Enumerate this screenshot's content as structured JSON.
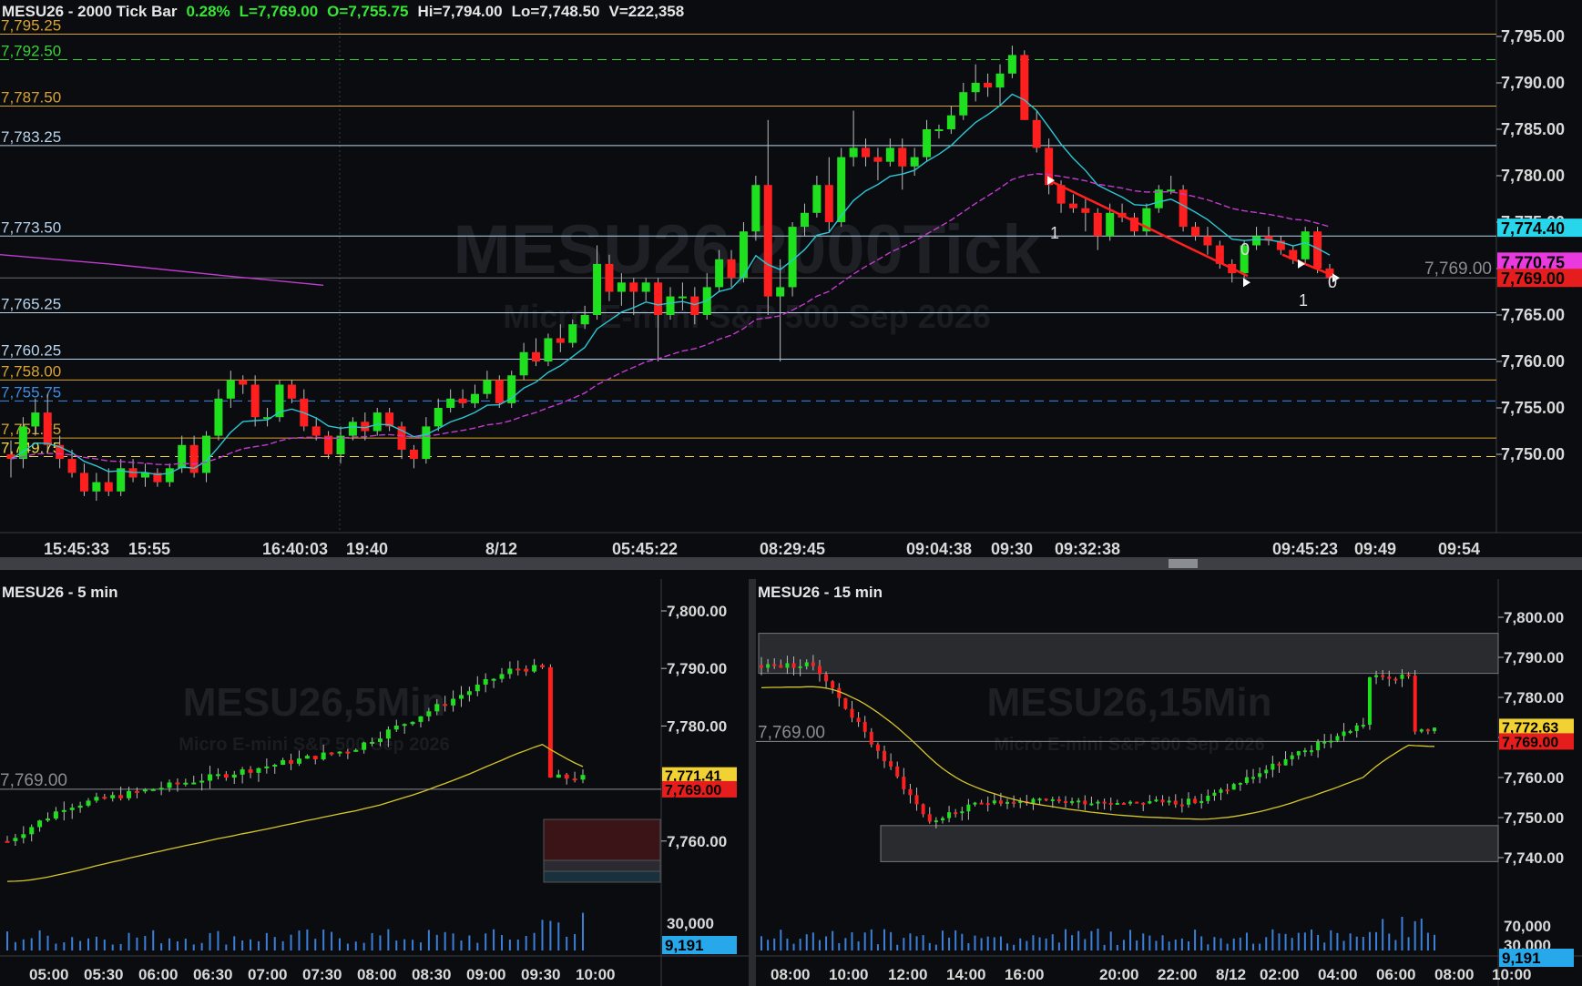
{
  "main": {
    "header": {
      "title": "MESU26 - 2000 Tick Bar",
      "change": "0.28%",
      "last": "L=7,769.00",
      "open": "O=7,755.75",
      "high": "Hi=7,794.00",
      "low": "Lo=7,748.50",
      "volume": "V=222,358"
    },
    "watermark": "MESU26,2000Tick",
    "watermark_sub": "Micro E-mini S&P 500 Sep 2026",
    "price_axis": [
      "7,795.00",
      "7,790.00",
      "7,785.00",
      "7,780.00",
      "7,775.00",
      "7,770.00",
      "7,765.00",
      "7,760.00",
      "7,755.00",
      "7,750.00"
    ],
    "levels": [
      {
        "label": "7,795.25",
        "price": 7795.25,
        "color": "#d8a330",
        "style": "solid"
      },
      {
        "label": "7,792.50",
        "price": 7792.5,
        "color": "#3ad13a",
        "style": "dashed"
      },
      {
        "label": "7,787.50",
        "price": 7787.5,
        "color": "#d8a330",
        "style": "solid"
      },
      {
        "label": "7,783.25",
        "price": 7783.25,
        "color": "#b8d4ee",
        "style": "solid"
      },
      {
        "label": "7,773.50",
        "price": 7773.5,
        "color": "#b8d4ee",
        "style": "solid"
      },
      {
        "label": "7,765.25",
        "price": 7765.25,
        "color": "#b8d4ee",
        "style": "solid"
      },
      {
        "label": "7,760.25",
        "price": 7760.25,
        "color": "#b8d4ee",
        "style": "solid"
      },
      {
        "label": "7,758.00",
        "price": 7758.0,
        "color": "#d8a330",
        "style": "solid"
      },
      {
        "label": "7,755.75",
        "price": 7755.75,
        "color": "#3a8ee8",
        "style": "dashed"
      },
      {
        "label": "7,751.75",
        "price": 7751.75,
        "color": "#d8a330",
        "style": "solid"
      },
      {
        "label": "7,749.75",
        "price": 7749.75,
        "color": "#f2d84a",
        "style": "dashed"
      }
    ],
    "last_price_line_label": "7,769.00",
    "price_tags": [
      {
        "text": "7,774.40",
        "price": 7774.4,
        "bg": "#27d6ea",
        "fg": "#000000"
      },
      {
        "text": "7,770.75",
        "price": 7770.75,
        "bg": "#e93ae0",
        "fg": "#000000"
      },
      {
        "text": "7,769.00",
        "price": 7769.0,
        "bg": "#e61d1d",
        "fg": "#000000"
      }
    ],
    "time_axis": [
      "15:45:33",
      "15:55",
      "16:40:03",
      "19:40",
      "8/12",
      "05:45:22",
      "08:29:45",
      "09:04:38",
      "09:30",
      "09:32:38",
      "09:45:23",
      "09:49",
      "09:54"
    ],
    "markers": [
      "1",
      "0",
      "0",
      "1"
    ],
    "candles": [
      [
        7750.0,
        7749.5,
        7747.5,
        7751.5
      ],
      [
        7749.5,
        7753.0,
        7748.5,
        7754.0
      ],
      [
        7753.0,
        7754.5,
        7752.0,
        7756.0
      ],
      [
        7754.5,
        7751.0,
        7750.5,
        7756.5
      ],
      [
        7751.0,
        7749.5,
        7748.5,
        7752.0
      ],
      [
        7749.5,
        7748.0,
        7747.5,
        7750.5
      ],
      [
        7748.0,
        7746.0,
        7745.5,
        7749.0
      ],
      [
        7746.0,
        7747.0,
        7745.0,
        7748.0
      ],
      [
        7747.0,
        7746.0,
        7745.5,
        7748.5
      ],
      [
        7746.0,
        7748.5,
        7745.5,
        7749.5
      ],
      [
        7748.5,
        7747.5,
        7747.0,
        7749.5
      ],
      [
        7747.5,
        7748.0,
        7746.5,
        7749.0
      ],
      [
        7748.0,
        7747.0,
        7746.5,
        7748.5
      ],
      [
        7747.0,
        7748.5,
        7746.5,
        7749.0
      ],
      [
        7748.5,
        7751.0,
        7748.0,
        7752.0
      ],
      [
        7751.0,
        7748.0,
        7747.5,
        7752.0
      ],
      [
        7748.0,
        7752.0,
        7747.0,
        7752.5
      ],
      [
        7752.0,
        7756.0,
        7751.5,
        7757.0
      ],
      [
        7756.0,
        7758.0,
        7755.0,
        7759.0
      ],
      [
        7758.0,
        7757.5,
        7756.5,
        7758.5
      ],
      [
        7757.5,
        7754.0,
        7753.0,
        7758.5
      ],
      [
        7754.0,
        7754.0,
        7753.0,
        7755.0
      ],
      [
        7754.0,
        7757.5,
        7753.5,
        7758.0
      ],
      [
        7757.5,
        7756.0,
        7755.5,
        7758.0
      ],
      [
        7756.0,
        7753.0,
        7752.5,
        7757.0
      ],
      [
        7753.0,
        7752.0,
        7751.5,
        7754.0
      ],
      [
        7752.0,
        7750.0,
        7749.5,
        7752.5
      ],
      [
        7750.0,
        7752.0,
        7749.0,
        7753.0
      ],
      [
        7752.0,
        7753.5,
        7751.5,
        7754.0
      ],
      [
        7753.5,
        7752.5,
        7751.5,
        7754.5
      ],
      [
        7752.5,
        7754.5,
        7752.0,
        7755.0
      ],
      [
        7754.5,
        7753.0,
        7752.5,
        7755.0
      ],
      [
        7753.0,
        7750.5,
        7749.5,
        7753.5
      ],
      [
        7750.5,
        7749.5,
        7748.5,
        7751.0
      ],
      [
        7749.5,
        7753.0,
        7749.0,
        7754.0
      ],
      [
        7753.0,
        7755.0,
        7752.5,
        7756.0
      ],
      [
        7755.0,
        7756.0,
        7754.5,
        7757.0
      ],
      [
        7756.0,
        7755.5,
        7755.0,
        7757.0
      ],
      [
        7755.5,
        7756.5,
        7755.0,
        7757.5
      ],
      [
        7756.5,
        7758.0,
        7756.0,
        7759.0
      ],
      [
        7758.0,
        7755.5,
        7755.0,
        7758.5
      ],
      [
        7755.5,
        7758.5,
        7755.0,
        7759.0
      ],
      [
        7758.5,
        7761.0,
        7758.0,
        7762.0
      ],
      [
        7761.0,
        7760.0,
        7759.5,
        7762.5
      ],
      [
        7760.0,
        7762.5,
        7759.5,
        7763.0
      ],
      [
        7762.5,
        7762.0,
        7761.0,
        7764.0
      ],
      [
        7762.0,
        7764.0,
        7761.5,
        7764.5
      ],
      [
        7764.0,
        7765.0,
        7763.5,
        7766.0
      ],
      [
        7765.0,
        7770.5,
        7764.5,
        7772.5
      ],
      [
        7770.5,
        7767.5,
        7766.5,
        7771.5
      ],
      [
        7767.5,
        7768.5,
        7766.0,
        7769.5
      ],
      [
        7768.5,
        7767.5,
        7765.0,
        7769.0
      ],
      [
        7767.5,
        7768.5,
        7766.5,
        7769.0
      ],
      [
        7768.5,
        7765.0,
        7760.0,
        7769.0
      ],
      [
        7765.0,
        7767.0,
        7764.5,
        7768.0
      ],
      [
        7767.0,
        7767.0,
        7765.5,
        7768.5
      ],
      [
        7767.0,
        7765.0,
        7764.0,
        7768.0
      ],
      [
        7765.0,
        7768.0,
        7764.5,
        7769.5
      ],
      [
        7768.0,
        7771.0,
        7767.5,
        7772.0
      ],
      [
        7771.0,
        7769.0,
        7768.0,
        7772.0
      ],
      [
        7769.0,
        7774.0,
        7768.5,
        7775.0
      ],
      [
        7774.0,
        7779.0,
        7773.0,
        7780.0
      ],
      [
        7779.0,
        7767.0,
        7765.0,
        7786.0
      ],
      [
        7767.0,
        7768.0,
        7760.0,
        7771.0
      ],
      [
        7768.0,
        7774.5,
        7767.0,
        7775.0
      ],
      [
        7774.5,
        7776.0,
        7773.5,
        7777.0
      ],
      [
        7776.0,
        7779.0,
        7775.5,
        7780.0
      ],
      [
        7779.0,
        7775.0,
        7774.0,
        7782.0
      ],
      [
        7775.0,
        7782.0,
        7774.5,
        7783.0
      ],
      [
        7782.0,
        7783.0,
        7781.0,
        7787.0
      ],
      [
        7783.0,
        7782.0,
        7781.0,
        7784.0
      ],
      [
        7782.0,
        7781.5,
        7779.5,
        7783.0
      ],
      [
        7781.5,
        7783.0,
        7781.0,
        7784.0
      ],
      [
        7783.0,
        7781.0,
        7778.5,
        7784.0
      ],
      [
        7781.0,
        7782.0,
        7780.0,
        7783.0
      ],
      [
        7782.0,
        7785.0,
        7781.5,
        7786.0
      ],
      [
        7785.0,
        7785.0,
        7784.0,
        7785.5
      ],
      [
        7785.0,
        7786.5,
        7784.5,
        7787.5
      ],
      [
        7786.5,
        7789.0,
        7786.0,
        7790.0
      ],
      [
        7789.0,
        7790.0,
        7788.0,
        7792.0
      ],
      [
        7790.0,
        7789.5,
        7788.5,
        7791.0
      ],
      [
        7789.5,
        7791.0,
        7787.5,
        7792.0
      ],
      [
        7791.0,
        7793.0,
        7790.5,
        7794.0
      ],
      [
        7793.0,
        7786.0,
        7786.0,
        7793.5
      ],
      [
        7786.0,
        7783.0,
        7782.5,
        7787.0
      ],
      [
        7783.0,
        7779.0,
        7778.0,
        7784.0
      ],
      [
        7779.0,
        7777.0,
        7776.0,
        7779.5
      ],
      [
        7777.0,
        7776.5,
        7776.0,
        7778.0
      ],
      [
        7776.5,
        7776.0,
        7774.0,
        7777.5
      ],
      [
        7776.0,
        7773.5,
        7772.0,
        7776.5
      ],
      [
        7773.5,
        7776.0,
        7773.0,
        7777.0
      ],
      [
        7776.0,
        7775.5,
        7775.0,
        7777.0
      ],
      [
        7775.5,
        7774.0,
        7773.5,
        7776.0
      ],
      [
        7774.0,
        7776.5,
        7773.5,
        7777.0
      ],
      [
        7776.5,
        7778.5,
        7776.0,
        7779.0
      ],
      [
        7778.5,
        7778.5,
        7778.0,
        7780.0
      ],
      [
        7778.5,
        7774.5,
        7774.0,
        7779.0
      ],
      [
        7774.5,
        7773.5,
        7773.0,
        7775.0
      ],
      [
        7773.5,
        7772.5,
        7771.5,
        7774.5
      ],
      [
        7772.5,
        7770.5,
        7770.0,
        7773.0
      ],
      [
        7770.5,
        7769.5,
        7768.5,
        7771.0
      ],
      [
        7769.5,
        7772.5,
        7769.0,
        7773.0
      ],
      [
        7772.5,
        7773.5,
        7772.0,
        7774.5
      ],
      [
        7773.5,
        7773.0,
        7772.5,
        7774.5
      ],
      [
        7773.0,
        7772.0,
        7771.5,
        7773.5
      ],
      [
        7772.0,
        7771.0,
        7770.5,
        7772.5
      ],
      [
        7771.0,
        7774.0,
        7770.5,
        7774.5
      ],
      [
        7774.0,
        7770.0,
        7769.5,
        7774.5
      ],
      [
        7770.0,
        7769.0,
        7768.0,
        7770.5
      ]
    ],
    "volume_hint": ""
  },
  "p5": {
    "title": "MESU26 - 5 min",
    "watermark": "MESU26,5Min",
    "watermark_sub": "Micro E-mini S&P 500 Sep 2026",
    "price_axis": [
      "7,800.00",
      "7,790.00",
      "7,780.00",
      "7,760.00"
    ],
    "last_line_label": "7,769.00",
    "tags": [
      {
        "text": "7,771.41",
        "price": 7771.41,
        "bg": "#f2d232",
        "fg": "#000000"
      },
      {
        "text": "7,769.00",
        "price": 7769.0,
        "bg": "#e61d1d",
        "fg": "#000000"
      }
    ],
    "volume_axis": "30,000",
    "volume_tag": "9,191",
    "time_axis": [
      "05:00",
      "05:30",
      "06:00",
      "06:30",
      "07:00",
      "07:30",
      "08:00",
      "08:30",
      "09:00",
      "09:30",
      "10:00"
    ]
  },
  "p15": {
    "title": "MESU26 - 15 min",
    "watermark": "MESU26,15Min",
    "watermark_sub": "Micro E-mini S&P 500 Sep 2026",
    "price_axis": [
      "7,800.00",
      "7,790.00",
      "7,780.00",
      "7,770.00",
      "7,760.00",
      "7,750.00",
      "7,740.00"
    ],
    "last_line_label": "7,769.00",
    "tags": [
      {
        "text": "7,772.63",
        "price": 7772.63,
        "bg": "#f2d232",
        "fg": "#000000"
      },
      {
        "text": "7,769.00",
        "price": 7769.0,
        "bg": "#e61d1d",
        "fg": "#000000"
      }
    ],
    "volume_axis": [
      "70,000",
      "30,000"
    ],
    "volume_tag": "9,191",
    "time_axis": [
      "08:00",
      "10:00",
      "12:00",
      "14:00",
      "16:00",
      "20:00",
      "22:00",
      "8/12",
      "02:00",
      "04:00",
      "06:00",
      "08:00",
      "10:00"
    ]
  },
  "colors": {
    "bull": "#1ee01e",
    "bear": "#ff1f1f",
    "ema_fast": "#2bc7d4",
    "ema_slow": "#c23bd0",
    "vwap": "#d7c62a",
    "grid_text": "#d9d9d9",
    "background": "#0b0c0f"
  }
}
